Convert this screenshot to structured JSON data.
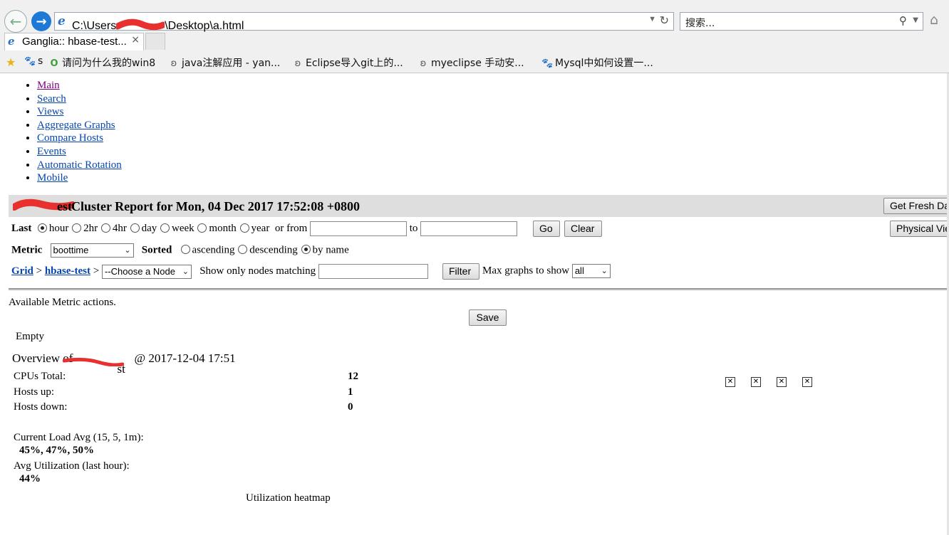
{
  "browser": {
    "address_prefix": "C:\\Users",
    "address_suffix": "\\Desktop\\a.html",
    "search_placeholder": "搜索...",
    "tab_title": "Ganglia:: hbase-test...",
    "tab_close": "×",
    "favorites": [
      {
        "icon": "paw-icon",
        "label": "s"
      },
      {
        "icon": "browser-360-icon",
        "label": "请问为什么我的win8"
      },
      {
        "icon": "scroll-icon",
        "label": "java注解应用 - yan..."
      },
      {
        "icon": "scroll-icon",
        "label": "Eclipse导入git上的..."
      },
      {
        "icon": "scroll-icon",
        "label": "myeclipse 手动安..."
      },
      {
        "icon": "paw-icon",
        "label": "Mysql中如何设置一..."
      }
    ]
  },
  "nav": {
    "items": [
      "Main",
      "Search",
      "Views",
      "Aggregate Graphs",
      "Compare Hosts",
      "Events",
      "Automatic Rotation",
      "Mobile"
    ]
  },
  "report": {
    "title": "Cluster Report for Mon, 04 Dec 2017 17:52:08 +0800",
    "title_fragment": "est",
    "get_fresh_label": "Get Fresh Data",
    "physical_view_label": "Physical View"
  },
  "range": {
    "label": "Last",
    "options": [
      "hour",
      "2hr",
      "4hr",
      "day",
      "week",
      "month",
      "year"
    ],
    "selected": "hour",
    "or_from": "or from",
    "to": "to",
    "go": "Go",
    "clear": "Clear"
  },
  "metric": {
    "label": "Metric",
    "value": "boottime",
    "sorted_label": "Sorted",
    "sort_options": [
      "ascending",
      "descending",
      "by name"
    ],
    "sort_selected": "by name"
  },
  "breadcrumb": {
    "grid": "Grid",
    "sep": ">",
    "cluster": "hbase-test",
    "node_select": "--Choose a Node",
    "filter_label": "Show only nodes matching",
    "filter_button": "Filter",
    "max_graphs_label": "Max graphs to show",
    "max_graphs_value": "all"
  },
  "metric_actions": {
    "text": "Available Metric actions.",
    "save": "Save",
    "empty": "Empty"
  },
  "overview": {
    "prefix": "Overview of",
    "suffix": "@ 2017-12-04 17:51",
    "suffix_fragment": "st",
    "stats": [
      {
        "label": "CPUs Total:",
        "value": "12"
      },
      {
        "label": "Hosts up:",
        "value": "1"
      },
      {
        "label": "Hosts down:",
        "value": "0"
      }
    ],
    "load_label": "Current Load Avg (15, 5, 1m):",
    "load_value": "45%, 47%, 50%",
    "util_label": "Avg Utilization (last hour):",
    "util_value": "44%",
    "heatmap_label": "Utilization heatmap"
  },
  "colors": {
    "redaction": "#e8302f",
    "link": "#0645ad",
    "visited_link": "#800080",
    "title_bar": "#dedede"
  }
}
